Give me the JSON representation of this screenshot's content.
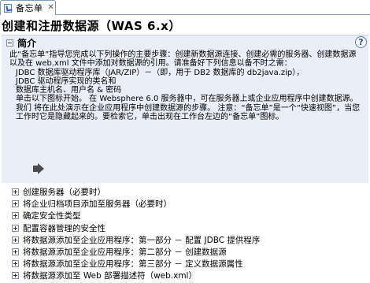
{
  "tab": {
    "label": "备忘单",
    "close_glyph": "✕"
  },
  "page_title": "创建和注册数据源（WAS 6.x）",
  "intro": {
    "title": "简介",
    "help_glyph": "?",
    "lines": [
      "此“备忘单”指导您完成以下列操作的主要步骤：创建新数据源连接、创建必需的服务器、创建数据源 以及在 web.xml 文件中添加对数据源的引用。请准备好下列信息以备不时之需：",
      "JDBC 数据库驱动程序库（JAR/ZIP）－（即，用于 DB2 数据库的 db2java.zip），",
      "JDBC 驱动程序实现的类名和",
      "数据库主机名、用户名 & 密码",
      "单击以下图标开始。 在 Websphere 6.0 服务器中，可在服务器上或企业应用程序中创建数据源。我们 将在此处演示在企业应用程序中创建数据源的步骤。 注意：“备忘单”是一个“快速视图”，当您工作时它是隐藏起来的。要检索它，单击出现在工作台左边的“备忘单”图标。"
    ]
  },
  "tasks": [
    {
      "label": "创建服务器（必要时）"
    },
    {
      "label": "将企业归档项目添加至服务器（必要时）"
    },
    {
      "label": "确定安全性类型"
    },
    {
      "label": "配置容器管理的安全性"
    },
    {
      "label": "将数据源添加至企业应用程序：第一部分 － 配置 JDBC 提供程序"
    },
    {
      "label": "将数据源添加至企业应用程序：第二部分 － 创建数据源"
    },
    {
      "label": "将数据源添加至企业应用程序：第三部分 － 定义数据源属性"
    },
    {
      "label": "将数据源添加至 Web 部署描述符（web.xml）"
    }
  ]
}
